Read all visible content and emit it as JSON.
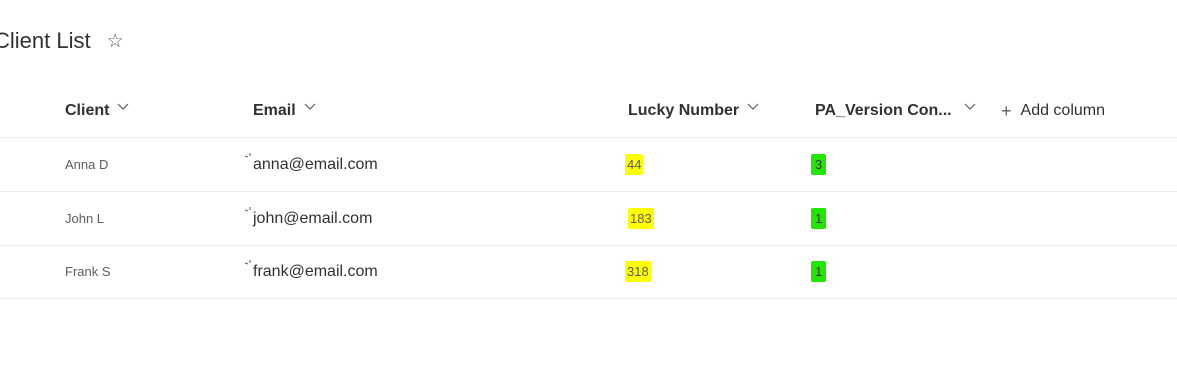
{
  "list": {
    "title": "Client List",
    "favorite_icon": "star-outline-icon"
  },
  "columns": [
    {
      "key": "client",
      "label": "Client",
      "icon": "chevron-down-icon"
    },
    {
      "key": "email",
      "label": "Email",
      "icon": "chevron-down-icon"
    },
    {
      "key": "lucky_number",
      "label": "Lucky Number",
      "icon": "chevron-down-icon"
    },
    {
      "key": "pa_version",
      "label": "PA_Version Con...",
      "icon": "chevron-down-icon"
    }
  ],
  "add_column": {
    "icon": "plus-icon",
    "label": "Add column"
  },
  "rows": [
    {
      "client": "Anna D",
      "email": "anna@email.com",
      "lucky_number": "44",
      "pa_version": "3"
    },
    {
      "client": "John L",
      "email": "john@email.com",
      "lucky_number": "183",
      "pa_version": "1"
    },
    {
      "client": "Frank S",
      "email": "frank@email.com",
      "lucky_number": "318",
      "pa_version": "1"
    }
  ],
  "colors": {
    "highlight_yellow": "#ffff00",
    "highlight_green": "#22e600",
    "divider": "#edebe9"
  }
}
